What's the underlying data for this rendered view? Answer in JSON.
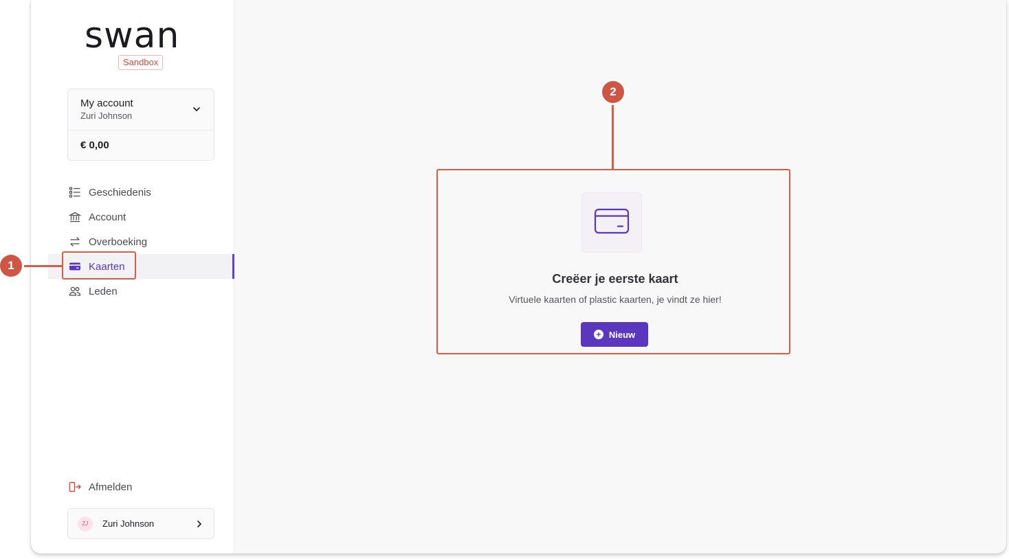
{
  "sidebar": {
    "logo": "swan",
    "environment": "Sandbox",
    "account": {
      "name": "My account",
      "holder": "Zuri Johnson",
      "balance": "€ 0,00"
    },
    "nav": [
      {
        "label": "Geschiedenis",
        "icon": "list-icon"
      },
      {
        "label": "Account",
        "icon": "bank-icon"
      },
      {
        "label": "Overboeking",
        "icon": "transfer-arrows-icon"
      },
      {
        "label": "Kaarten",
        "icon": "card-icon",
        "active": true
      },
      {
        "label": "Leden",
        "icon": "people-icon"
      }
    ],
    "logout": "Afmelden",
    "user": {
      "initials": "ZJ",
      "name": "Zuri Johnson"
    }
  },
  "main": {
    "empty_state": {
      "title": "Creëer je eerste kaart",
      "description": "Virtuele kaarten of plastic kaarten, je vindt ze hier!",
      "button": "Nieuw"
    }
  },
  "annotations": [
    {
      "number": "1"
    },
    {
      "number": "2"
    }
  ],
  "colors": {
    "accent": "#5b37bf",
    "annotation": "#d65b4a",
    "sandbox": "#d3493b"
  }
}
